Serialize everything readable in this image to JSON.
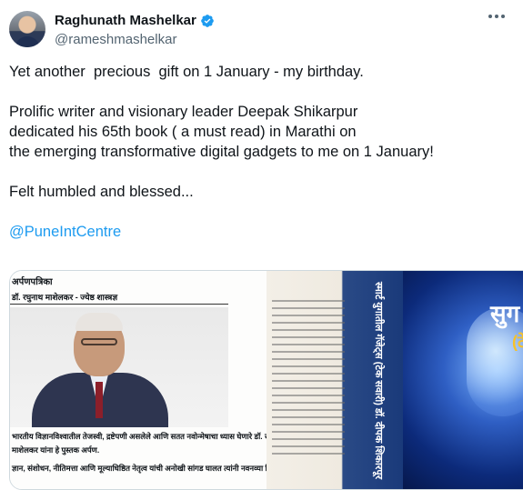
{
  "author": {
    "name": "Raghunath Mashelkar",
    "handle": "@rameshmashelkar",
    "verified_color": "#1d9bf0"
  },
  "tweet": {
    "line1": "Yet another  precious  gift on 1 January - my birthday.",
    "line2a": "Prolific writer and visionary leader Deepak Shikarpur",
    "line2b": "dedicated his 65th book ( a must read) in Marathi on",
    "line2c": "the emerging transformative digital gadgets to me on 1 January!",
    "line3": "Felt humbled and blessed...",
    "mention": "@PuneIntCentre",
    "link_color": "#1d9bf0"
  },
  "media": {
    "dedication_heading": "अर्पणपत्रिका",
    "dedication_name": "डॉ. रघुनाथ माशेलकर - ज्येष्ठ शास्त्रज्ञ",
    "dedication_line1": "भारतीय विज्ञानविश्वातील तेजस्वी, द्रष्टेपणी असलेले आणि सतत नवोन्मेषाचा ध्यास घेणारे डॉ. रघुनाथ",
    "dedication_line2": "माशेलकर यांना हे पुस्तक अर्पण.",
    "dedication_line3": "ज्ञान, संशोधन, नीतिमत्ता आणि मूल्याधिष्ठित नेतृत्व यांची अनोखी सांगड घालत त्यांनी नवनव्या दिश",
    "spine_text": "स्मार्ट युगातील गॅजेट्स (टेक सवारी)   डॉ. दीपक शिकारपूर",
    "cover_title": "सुग",
    "cover_subtitle": "(टेक"
  }
}
